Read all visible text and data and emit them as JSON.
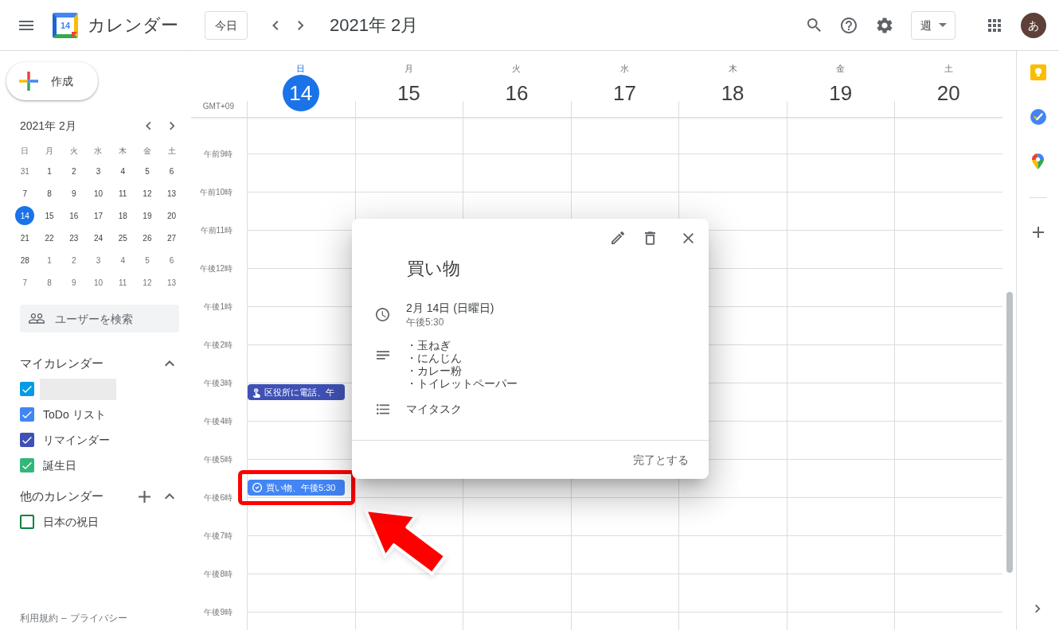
{
  "header": {
    "app_name": "カレンダー",
    "logo_date": "14",
    "today_button": "今日",
    "period": "2021年 2月",
    "view_selector": "週",
    "avatar_letter": "あ"
  },
  "sidebar": {
    "create_button": "作成",
    "mini_calendar": {
      "title": "2021年 2月",
      "weekdays": [
        "日",
        "月",
        "火",
        "水",
        "木",
        "金",
        "土"
      ],
      "weeks": [
        [
          {
            "day": "31",
            "in_month": false,
            "selected": false
          },
          {
            "day": "1",
            "in_month": true,
            "selected": false
          },
          {
            "day": "2",
            "in_month": true,
            "selected": false
          },
          {
            "day": "3",
            "in_month": true,
            "selected": false
          },
          {
            "day": "4",
            "in_month": true,
            "selected": false
          },
          {
            "day": "5",
            "in_month": true,
            "selected": false
          },
          {
            "day": "6",
            "in_month": true,
            "selected": false
          }
        ],
        [
          {
            "day": "7",
            "in_month": true,
            "selected": false
          },
          {
            "day": "8",
            "in_month": true,
            "selected": false
          },
          {
            "day": "9",
            "in_month": true,
            "selected": false
          },
          {
            "day": "10",
            "in_month": true,
            "selected": false
          },
          {
            "day": "11",
            "in_month": true,
            "selected": false
          },
          {
            "day": "12",
            "in_month": true,
            "selected": false
          },
          {
            "day": "13",
            "in_month": true,
            "selected": false
          }
        ],
        [
          {
            "day": "14",
            "in_month": true,
            "selected": true
          },
          {
            "day": "15",
            "in_month": true,
            "selected": false
          },
          {
            "day": "16",
            "in_month": true,
            "selected": false
          },
          {
            "day": "17",
            "in_month": true,
            "selected": false
          },
          {
            "day": "18",
            "in_month": true,
            "selected": false
          },
          {
            "day": "19",
            "in_month": true,
            "selected": false
          },
          {
            "day": "20",
            "in_month": true,
            "selected": false
          }
        ],
        [
          {
            "day": "21",
            "in_month": true,
            "selected": false
          },
          {
            "day": "22",
            "in_month": true,
            "selected": false
          },
          {
            "day": "23",
            "in_month": true,
            "selected": false
          },
          {
            "day": "24",
            "in_month": true,
            "selected": false
          },
          {
            "day": "25",
            "in_month": true,
            "selected": false
          },
          {
            "day": "26",
            "in_month": true,
            "selected": false
          },
          {
            "day": "27",
            "in_month": true,
            "selected": false
          }
        ],
        [
          {
            "day": "28",
            "in_month": true,
            "selected": false
          },
          {
            "day": "1",
            "in_month": false,
            "selected": false
          },
          {
            "day": "2",
            "in_month": false,
            "selected": false
          },
          {
            "day": "3",
            "in_month": false,
            "selected": false
          },
          {
            "day": "4",
            "in_month": false,
            "selected": false
          },
          {
            "day": "5",
            "in_month": false,
            "selected": false
          },
          {
            "day": "6",
            "in_month": false,
            "selected": false
          }
        ],
        [
          {
            "day": "7",
            "in_month": false,
            "selected": false
          },
          {
            "day": "8",
            "in_month": false,
            "selected": false
          },
          {
            "day": "9",
            "in_month": false,
            "selected": false
          },
          {
            "day": "10",
            "in_month": false,
            "selected": false
          },
          {
            "day": "11",
            "in_month": false,
            "selected": false
          },
          {
            "day": "12",
            "in_month": false,
            "selected": false
          },
          {
            "day": "13",
            "in_month": false,
            "selected": false
          }
        ]
      ]
    },
    "people_search": {
      "placeholder": "ユーザーを検索"
    },
    "my_calendars": {
      "title": "マイカレンダー",
      "expanded": true,
      "items": [
        {
          "kind": "redacted",
          "checked": true,
          "color": "#039be5"
        },
        {
          "kind": "named",
          "label": "ToDo リスト",
          "checked": true,
          "color": "#4285f4"
        },
        {
          "kind": "named",
          "label": "リマインダー",
          "checked": true,
          "color": "#3f51b5"
        },
        {
          "kind": "named",
          "label": "誕生日",
          "checked": true,
          "color": "#33b679"
        }
      ]
    },
    "other_calendars": {
      "title": "他のカレンダー",
      "expanded": true,
      "items": [
        {
          "kind": "named",
          "label": "日本の祝日",
          "checked": false,
          "color": "#0b8043"
        }
      ]
    },
    "footer": {
      "terms": "利用規約",
      "separator": "–",
      "privacy": "プライバシー"
    }
  },
  "week_view": {
    "timezone": "GMT+09",
    "days": [
      {
        "weekday": "日",
        "date": "14",
        "selected": true
      },
      {
        "weekday": "月",
        "date": "15",
        "selected": false
      },
      {
        "weekday": "火",
        "date": "16",
        "selected": false
      },
      {
        "weekday": "水",
        "date": "17",
        "selected": false
      },
      {
        "weekday": "木",
        "date": "18",
        "selected": false
      },
      {
        "weekday": "金",
        "date": "19",
        "selected": false
      },
      {
        "weekday": "土",
        "date": "20",
        "selected": false
      }
    ],
    "hours": [
      {
        "label": "午前9時"
      },
      {
        "label": "午前10時"
      },
      {
        "label": "午前11時"
      },
      {
        "label": "午後12時"
      },
      {
        "label": "午後1時"
      },
      {
        "label": "午後2時"
      },
      {
        "label": "午後3時",
        "cells": [
          {
            "on_the_hour": [
              {
                "kind": "reminder",
                "title": "区役所に電話、午",
                "color": "#3f51b5",
                "highlighted": false
              }
            ]
          }
        ]
      },
      {
        "label": "午後4時"
      },
      {
        "label": "午後5時",
        "cells": [
          {
            "half_past": [
              {
                "kind": "task",
                "title": "買い物、午後5:30",
                "color": "#4285f4",
                "highlighted": true
              }
            ]
          }
        ]
      },
      {
        "label": "午後6時"
      },
      {
        "label": "午後7時"
      },
      {
        "label": "午後8時"
      },
      {
        "label": "午後9時"
      }
    ]
  },
  "event_popup": {
    "title": "買い物",
    "date": "2月 14日 (日曜日)",
    "time": "午後5:30",
    "description": [
      "・玉ねぎ",
      "・にんじん",
      "・カレー粉",
      "・トイレットペーパー"
    ],
    "task_list": "マイタスク",
    "action": "完了とする"
  }
}
